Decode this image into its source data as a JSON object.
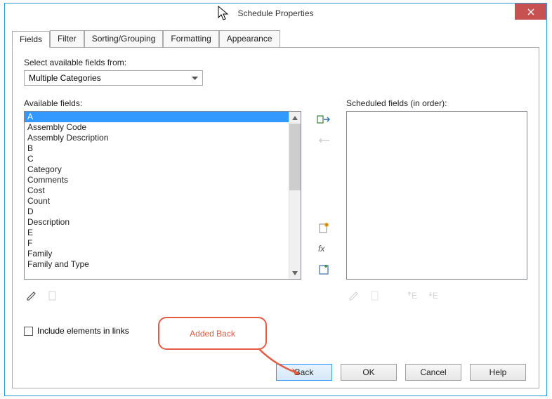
{
  "window": {
    "title": "Schedule Properties"
  },
  "tabs": [
    {
      "label": "Fields",
      "active": true
    },
    {
      "label": "Filter",
      "active": false
    },
    {
      "label": "Sorting/Grouping",
      "active": false
    },
    {
      "label": "Formatting",
      "active": false
    },
    {
      "label": "Appearance",
      "active": false
    }
  ],
  "labels": {
    "select_from": "Select available fields from:",
    "available_fields": "Available fields:",
    "scheduled_fields": "Scheduled fields (in order):",
    "include_links": "Include elements in links"
  },
  "dropdown": {
    "value": "Multiple Categories"
  },
  "available_items": [
    {
      "text": "A",
      "selected": true
    },
    {
      "text": "Assembly Code",
      "selected": false
    },
    {
      "text": "Assembly Description",
      "selected": false
    },
    {
      "text": "B",
      "selected": false
    },
    {
      "text": "C",
      "selected": false
    },
    {
      "text": "Category",
      "selected": false
    },
    {
      "text": "Comments",
      "selected": false
    },
    {
      "text": "Cost",
      "selected": false
    },
    {
      "text": "Count",
      "selected": false
    },
    {
      "text": "D",
      "selected": false
    },
    {
      "text": "Description",
      "selected": false
    },
    {
      "text": "E",
      "selected": false
    },
    {
      "text": "F",
      "selected": false
    },
    {
      "text": "Family",
      "selected": false
    },
    {
      "text": "Family and Type",
      "selected": false
    }
  ],
  "buttons": {
    "back": "Back",
    "ok": "OK",
    "cancel": "Cancel",
    "help": "Help"
  },
  "annotation": {
    "text": "Added Back"
  }
}
